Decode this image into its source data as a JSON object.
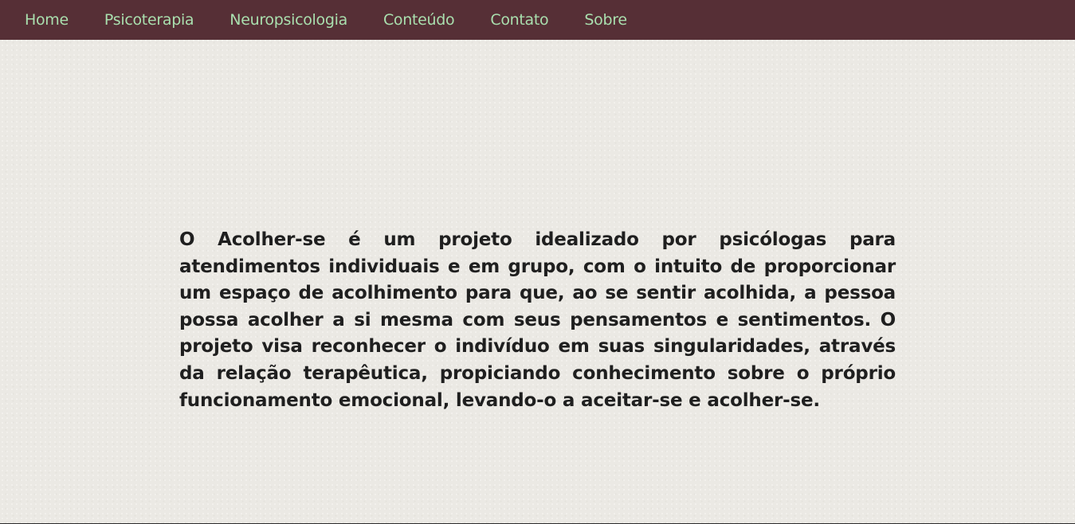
{
  "nav": {
    "items": [
      {
        "label": "Home"
      },
      {
        "label": "Psicoterapia"
      },
      {
        "label": "Neuropsicologia"
      },
      {
        "label": "Conteúdo"
      },
      {
        "label": "Contato"
      },
      {
        "label": "Sobre"
      }
    ]
  },
  "main": {
    "description": "O Acolher-se é um projeto idealizado por psicólogas para atendimentos individuais e em grupo, com o intuito de proporcionar um espaço de acolhimento para que, ao se sentir acolhida, a pessoa possa acolher a si mesma com seus pensamentos e sentimentos. O projeto visa reconhecer o indivíduo em suas singularidades, através da relação terapêutica, propiciando conhecimento sobre o próprio funcionamento emocional, levando-o a aceitar-se e acolher-se."
  },
  "colors": {
    "navbar_bg": "#562f36",
    "nav_text": "#a9dfae",
    "page_bg": "#ebe9e4",
    "body_text": "#1f1f1f"
  }
}
